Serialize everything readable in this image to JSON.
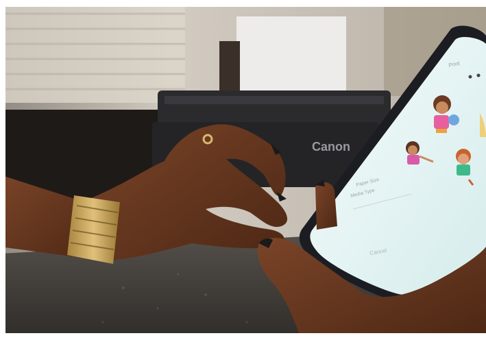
{
  "photo": {
    "printer_brand": "Canon",
    "phone_screen": {
      "header": "Print",
      "paper_size_label": "Paper Size",
      "media_type_label": "Media Type",
      "cancel_label": "Cancel"
    }
  },
  "colors": {
    "wall": "#c9c2b8",
    "window": "#ded8cd",
    "printer_body": "#2a2a2c",
    "counter": "#4a4744",
    "skin": "#6b3a22",
    "skin_highlight": "#8a4f30",
    "watch_gold": "#c8a35a",
    "phone_frame": "#1c1d22",
    "phone_screen": "#e6f2f2"
  },
  "icons": [
    "printer-icon",
    "phone-icon",
    "watch-icon",
    "cartoon-character-icon"
  ]
}
